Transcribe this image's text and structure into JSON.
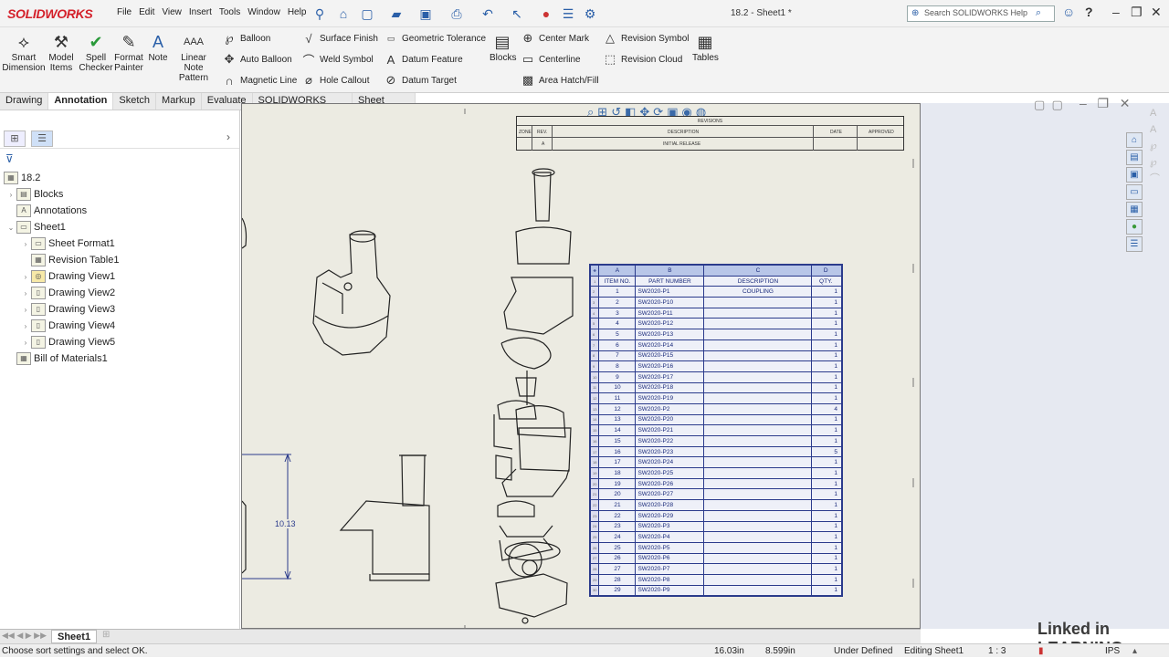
{
  "titlebar": {
    "app_name": "SOLIDWORKS",
    "menus": [
      "File",
      "Edit",
      "View",
      "Insert",
      "Tools",
      "Window",
      "Help"
    ],
    "document_title": "18.2 - Sheet1 *",
    "search_placeholder": "Search SOLIDWORKS Help",
    "help_label": "?"
  },
  "ribbon": {
    "big_buttons": [
      {
        "label": "Smart Dimension",
        "icon": "smart-dimension-icon"
      },
      {
        "label": "Model Items",
        "icon": "model-items-icon"
      },
      {
        "label": "Spell Checker",
        "icon": "spell-checker-icon"
      },
      {
        "label": "Format Painter",
        "icon": "format-painter-icon"
      },
      {
        "label": "Note",
        "icon": "note-icon"
      },
      {
        "label": "Linear Note Pattern",
        "icon": "linear-note-pattern-icon"
      }
    ],
    "col1": [
      "Balloon",
      "Auto Balloon",
      "Magnetic Line"
    ],
    "col2": [
      "Surface Finish",
      "Weld Symbol",
      "Hole Callout"
    ],
    "col3": [
      "Geometric Tolerance",
      "Datum Feature",
      "Datum Target"
    ],
    "blocks_label": "Blocks",
    "col4": [
      "Center Mark",
      "Centerline",
      "Area Hatch/Fill"
    ],
    "col5": [
      "Revision Symbol",
      "Revision Cloud"
    ],
    "tables_label": "Tables"
  },
  "tabs": [
    "Drawing",
    "Annotation",
    "Sketch",
    "Markup",
    "Evaluate",
    "SOLIDWORKS Add-Ins",
    "Sheet Format"
  ],
  "active_tab": "Annotation",
  "tree": {
    "root": "18.2",
    "items": [
      {
        "label": "Blocks",
        "level": 1
      },
      {
        "label": "Annotations",
        "level": 1
      },
      {
        "label": "Sheet1",
        "level": 1
      },
      {
        "label": "Sheet Format1",
        "level": 2
      },
      {
        "label": "Revision Table1",
        "level": 2
      },
      {
        "label": "Drawing View1",
        "level": 2
      },
      {
        "label": "Drawing View2",
        "level": 2
      },
      {
        "label": "Drawing View3",
        "level": 2
      },
      {
        "label": "Drawing View4",
        "level": 2
      },
      {
        "label": "Drawing View5",
        "level": 2
      },
      {
        "label": "Bill of Materials1",
        "level": 1
      }
    ]
  },
  "revision_table": {
    "title": "REVISIONS",
    "headers": [
      "ZONE",
      "REV.",
      "DESCRIPTION",
      "DATE",
      "APPROVED"
    ],
    "rows": [
      [
        "",
        "A",
        "INITIAL RELEASE",
        "",
        ""
      ]
    ]
  },
  "dimension_label": "10.13",
  "bom": {
    "column_letters": [
      "A",
      "B",
      "C",
      "D"
    ],
    "headers": [
      "ITEM NO.",
      "PART NUMBER",
      "DESCRIPTION",
      "QTY."
    ],
    "rows": [
      [
        "1",
        "SW2020-P1",
        "COUPLING",
        "1"
      ],
      [
        "2",
        "SW2020-P10",
        "",
        "1"
      ],
      [
        "3",
        "SW2020-P11",
        "",
        "1"
      ],
      [
        "4",
        "SW2020-P12",
        "",
        "1"
      ],
      [
        "5",
        "SW2020-P13",
        "",
        "1"
      ],
      [
        "6",
        "SW2020-P14",
        "",
        "1"
      ],
      [
        "7",
        "SW2020-P15",
        "",
        "1"
      ],
      [
        "8",
        "SW2020-P16",
        "",
        "1"
      ],
      [
        "9",
        "SW2020-P17",
        "",
        "1"
      ],
      [
        "10",
        "SW2020-P18",
        "",
        "1"
      ],
      [
        "11",
        "SW2020-P19",
        "",
        "1"
      ],
      [
        "12",
        "SW2020-P2",
        "",
        "4"
      ],
      [
        "13",
        "SW2020-P20",
        "",
        "1"
      ],
      [
        "14",
        "SW2020-P21",
        "",
        "1"
      ],
      [
        "15",
        "SW2020-P22",
        "",
        "1"
      ],
      [
        "16",
        "SW2020-P23",
        "",
        "5"
      ],
      [
        "17",
        "SW2020-P24",
        "",
        "1"
      ],
      [
        "18",
        "SW2020-P25",
        "",
        "1"
      ],
      [
        "19",
        "SW2020-P26",
        "",
        "1"
      ],
      [
        "20",
        "SW2020-P27",
        "",
        "1"
      ],
      [
        "21",
        "SW2020-P28",
        "",
        "1"
      ],
      [
        "22",
        "SW2020-P29",
        "",
        "1"
      ],
      [
        "23",
        "SW2020-P3",
        "",
        "1"
      ],
      [
        "24",
        "SW2020-P4",
        "",
        "1"
      ],
      [
        "25",
        "SW2020-P5",
        "",
        "1"
      ],
      [
        "26",
        "SW2020-P6",
        "",
        "1"
      ],
      [
        "27",
        "SW2020-P7",
        "",
        "1"
      ],
      [
        "28",
        "SW2020-P8",
        "",
        "1"
      ],
      [
        "29",
        "SW2020-P9",
        "",
        "1"
      ]
    ]
  },
  "sheet_tab": "Sheet1",
  "status": {
    "message": "Choose sort settings and select OK.",
    "x": "16.03in",
    "y": "8.599in",
    "state": "Under Defined",
    "editing": "Editing Sheet1",
    "scale": "1 : 3",
    "units": "IPS"
  },
  "watermark": "Linked in LEARNING",
  "colors": {
    "accent": "#2a5fa8",
    "bom_border": "#2b3b8c",
    "sheet": "#ecebe2"
  }
}
